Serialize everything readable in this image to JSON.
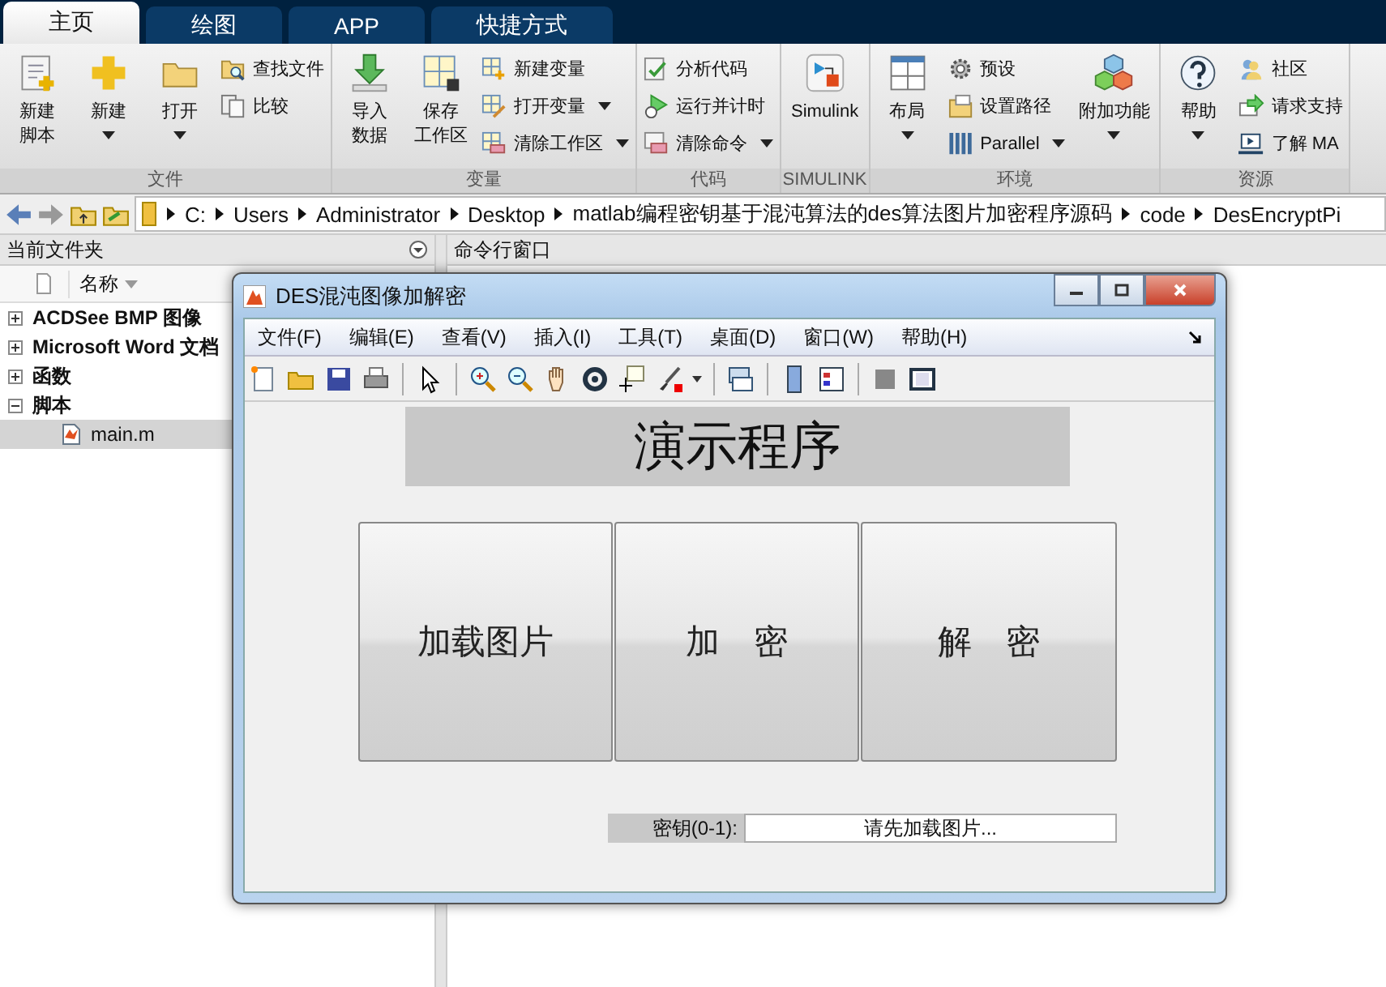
{
  "tabs": [
    {
      "label": "主页",
      "selected": true
    },
    {
      "label": "绘图",
      "selected": false
    },
    {
      "label": "APP",
      "selected": false
    },
    {
      "label": "快捷方式",
      "selected": false
    }
  ],
  "ribbon": [
    {
      "label": "文件",
      "columns": [
        {
          "kind": "large",
          "items": [
            {
              "lines": [
                "新建",
                "脚本"
              ],
              "dropdown": false
            }
          ]
        },
        {
          "kind": "large",
          "items": [
            {
              "lines": [
                "新建"
              ],
              "dropdown": true
            }
          ]
        },
        {
          "kind": "large",
          "items": [
            {
              "lines": [
                "打开"
              ],
              "dropdown": true
            }
          ]
        },
        {
          "kind": "small",
          "items": [
            {
              "lines": [
                "查找文件"
              ],
              "dropdown": false
            },
            {
              "lines": [
                "比较"
              ],
              "dropdown": false
            }
          ]
        }
      ]
    },
    {
      "label": "变量",
      "columns": [
        {
          "kind": "large",
          "items": [
            {
              "lines": [
                "导入",
                "数据"
              ],
              "dropdown": false
            }
          ]
        },
        {
          "kind": "large",
          "items": [
            {
              "lines": [
                "保存",
                "工作区"
              ],
              "dropdown": false
            }
          ]
        },
        {
          "kind": "small",
          "items": [
            {
              "lines": [
                "新建变量"
              ],
              "dropdown": false
            },
            {
              "lines": [
                "打开变量"
              ],
              "dropdown": true
            },
            {
              "lines": [
                "清除工作区"
              ],
              "dropdown": true
            }
          ]
        }
      ]
    },
    {
      "label": "代码",
      "columns": [
        {
          "kind": "small",
          "items": [
            {
              "lines": [
                "分析代码"
              ],
              "dropdown": false
            },
            {
              "lines": [
                "运行并计时"
              ],
              "dropdown": false
            },
            {
              "lines": [
                "清除命令"
              ],
              "dropdown": true
            }
          ]
        }
      ]
    },
    {
      "label": "SIMULINK",
      "columns": [
        {
          "kind": "large",
          "items": [
            {
              "lines": [
                "Simulink"
              ],
              "dropdown": false
            }
          ]
        }
      ]
    },
    {
      "label": "环境",
      "columns": [
        {
          "kind": "large",
          "items": [
            {
              "lines": [
                "布局"
              ],
              "dropdown": true
            }
          ]
        },
        {
          "kind": "small",
          "items": [
            {
              "lines": [
                "预设"
              ],
              "dropdown": false
            },
            {
              "lines": [
                "设置路径"
              ],
              "dropdown": false
            },
            {
              "lines": [
                "Parallel"
              ],
              "dropdown": true
            }
          ]
        },
        {
          "kind": "large",
          "items": [
            {
              "lines": [
                "附加功能"
              ],
              "dropdown": true
            }
          ]
        }
      ]
    },
    {
      "label": "资源",
      "columns": [
        {
          "kind": "large",
          "items": [
            {
              "lines": [
                "帮助"
              ],
              "dropdown": true
            }
          ]
        },
        {
          "kind": "small",
          "items": [
            {
              "lines": [
                "社区"
              ],
              "dropdown": false
            },
            {
              "lines": [
                "请求支持"
              ],
              "dropdown": false
            },
            {
              "lines": [
                "了解 MA"
              ],
              "dropdown": false
            }
          ]
        }
      ]
    }
  ],
  "address": [
    "C:",
    "Users",
    "Administrator",
    "Desktop",
    "matlab编程密钥基于混沌算法的des算法图片加密程序源码",
    "code",
    "DesEncryptPi"
  ],
  "file_panel": {
    "title": "当前文件夹",
    "column": "名称",
    "tree": [
      {
        "label": "ACDSee BMP 图像",
        "expanded": false,
        "selected": false
      },
      {
        "label": "Microsoft Word 文档",
        "expanded": false,
        "selected": false
      },
      {
        "label": "函数",
        "expanded": false,
        "selected": false
      },
      {
        "label": "脚本",
        "expanded": true,
        "selected": false,
        "children": [
          {
            "label": "main.m",
            "selected": true
          }
        ]
      }
    ]
  },
  "command_panel": {
    "title": "命令行窗口"
  },
  "figure": {
    "title": "DES混沌图像加解密",
    "menu": [
      "文件(F)",
      "编辑(E)",
      "查看(V)",
      "插入(I)",
      "工具(T)",
      "桌面(D)",
      "窗口(W)",
      "帮助(H)"
    ],
    "heading": "演示程序",
    "buttons": [
      "加载图片",
      "加    密",
      "解    密"
    ],
    "key_label": "密钥(0-1):",
    "key_value": "请先加载图片..."
  }
}
